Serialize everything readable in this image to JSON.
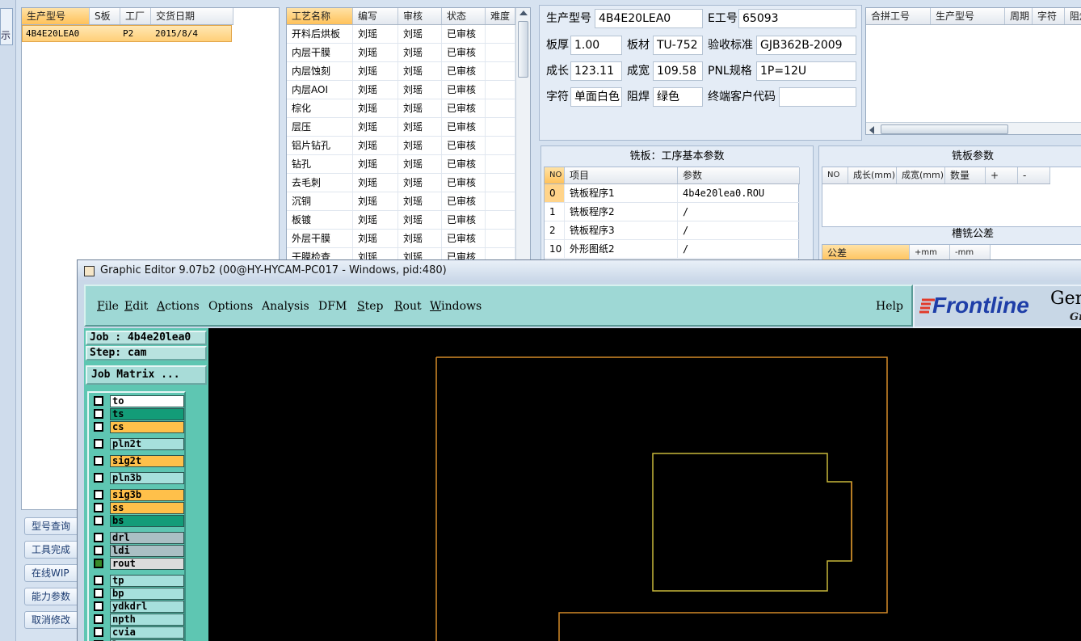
{
  "left_edge": {
    "show_label": "示"
  },
  "order_table": {
    "columns": [
      "生产型号",
      "S板",
      "工厂",
      "交货日期"
    ],
    "rows": [
      [
        "4B4E20LEA0",
        "",
        "P2",
        "2015/8/4"
      ]
    ]
  },
  "process_table": {
    "columns": [
      "工艺名称",
      "编写",
      "审核",
      "状态",
      "难度"
    ],
    "rows": [
      [
        "开料后烘板",
        "刘瑶",
        "刘瑶",
        "已审核",
        ""
      ],
      [
        "内层干膜",
        "刘瑶",
        "刘瑶",
        "已审核",
        ""
      ],
      [
        "内层蚀刻",
        "刘瑶",
        "刘瑶",
        "已审核",
        ""
      ],
      [
        "内层AOI",
        "刘瑶",
        "刘瑶",
        "已审核",
        ""
      ],
      [
        "棕化",
        "刘瑶",
        "刘瑶",
        "已审核",
        ""
      ],
      [
        "层压",
        "刘瑶",
        "刘瑶",
        "已审核",
        ""
      ],
      [
        "铝片钻孔",
        "刘瑶",
        "刘瑶",
        "已审核",
        ""
      ],
      [
        "钻孔",
        "刘瑶",
        "刘瑶",
        "已审核",
        ""
      ],
      [
        "去毛刺",
        "刘瑶",
        "刘瑶",
        "已审核",
        ""
      ],
      [
        "沉铜",
        "刘瑶",
        "刘瑶",
        "已审核",
        ""
      ],
      [
        "板镀",
        "刘瑶",
        "刘瑶",
        "已审核",
        ""
      ],
      [
        "外层干膜",
        "刘瑶",
        "刘瑶",
        "已审核",
        ""
      ],
      [
        "干膜检查",
        "刘瑶",
        "刘瑶",
        "已审核",
        ""
      ]
    ]
  },
  "side_buttons": [
    "型号查询",
    "工具完成",
    "在线WIP",
    "能力参数",
    "取消修改"
  ],
  "product_info": {
    "model_label": "生产型号",
    "model_value": "4B4E20LEA0",
    "e_label": "E工号",
    "e_value": "65093",
    "thickness_label": "板厚",
    "thickness_value": "1.00",
    "material_label": "板材",
    "material_value": "TU-752",
    "standard_label": "验收标准",
    "standard_value": "GJB362B-2009",
    "length_label": "成长",
    "length_value": "123.11",
    "width_label": "成宽",
    "width_value": "109.58",
    "pnl_label": "PNL规格",
    "pnl_value": "1P=12U",
    "char_label": "字符",
    "char_value": "单面白色",
    "mask_label": "阻焊",
    "mask_value": "绿色",
    "customer_label": "终端客户代码",
    "customer_value": ""
  },
  "merge_table": {
    "columns": [
      "合拼工号",
      "生产型号",
      "周期",
      "字符",
      "阻焊"
    ]
  },
  "milling_basic": {
    "title": "铣板：工序基本参数",
    "columns": [
      "NO",
      "项目",
      "参数"
    ],
    "rows": [
      [
        "0",
        "铣板程序1",
        "4b4e20lea0.ROU"
      ],
      [
        "1",
        "铣板程序2",
        "/"
      ],
      [
        "2",
        "铣板程序3",
        "/"
      ],
      [
        "10",
        "外形图纸2",
        "/"
      ]
    ]
  },
  "milling_params": {
    "title": "铣板参数",
    "columns": [
      "NO",
      "成长(mm)",
      "成宽(mm)",
      "数量",
      "+",
      "-"
    ]
  },
  "slot_tolerance": {
    "title": "槽铣公差",
    "columns": [
      "公差",
      "+mm",
      "-mm"
    ]
  },
  "graphic_editor": {
    "title": "Graphic Editor 9.07b2 (00@HY-HYCAM-PC017 - Windows, pid:480)",
    "menu": [
      {
        "label": "File",
        "underline": "F"
      },
      {
        "label": "Edit",
        "underline": "E"
      },
      {
        "label": "Actions",
        "underline": "A"
      },
      {
        "label": "Options",
        "underline": ""
      },
      {
        "label": "Analysis",
        "underline": ""
      },
      {
        "label": "DFM",
        "underline": ""
      },
      {
        "label": "Step",
        "underline": "S"
      },
      {
        "label": "Rout",
        "underline": "R"
      },
      {
        "label": "Windows",
        "underline": "W"
      }
    ],
    "help": "Help",
    "brand": "Frontline",
    "brand_suffix": "Gen",
    "brand_sub": "Gr",
    "job": "Job : 4b4e20lea0",
    "step": "Step: cam",
    "job_matrix": "Job Matrix ...",
    "layers": [
      {
        "name": "to",
        "color": "#ffffff",
        "on": false
      },
      {
        "name": "ts",
        "color": "#139c78",
        "on": false
      },
      {
        "name": "cs",
        "color": "#ffc04a",
        "on": false
      },
      {
        "name": "pln2t",
        "color": "#a6e0dc",
        "on": false
      },
      {
        "name": "sig2t",
        "color": "#ffc04a",
        "on": false
      },
      {
        "name": "pln3b",
        "color": "#a6e0dc",
        "on": false
      },
      {
        "name": "sig3b",
        "color": "#ffc04a",
        "on": false
      },
      {
        "name": "ss",
        "color": "#ffc04a",
        "on": false
      },
      {
        "name": "bs",
        "color": "#139c78",
        "on": false
      },
      {
        "name": "drl",
        "color": "#aabfc4",
        "on": false
      },
      {
        "name": "ldi",
        "color": "#aabfc4",
        "on": false
      },
      {
        "name": "rout",
        "color": "#dcdcdc",
        "on": true
      },
      {
        "name": "tp",
        "color": "#a6e0dc",
        "on": false
      },
      {
        "name": "bp",
        "color": "#a6e0dc",
        "on": false
      },
      {
        "name": "ydkdrl",
        "color": "#a6e0dc",
        "on": false
      },
      {
        "name": "npth",
        "color": "#a6e0dc",
        "on": false
      },
      {
        "name": "cvia",
        "color": "#a6e0dc",
        "on": false
      },
      {
        "name": "l",
        "color": "#a6e0dc",
        "on": false
      }
    ]
  }
}
